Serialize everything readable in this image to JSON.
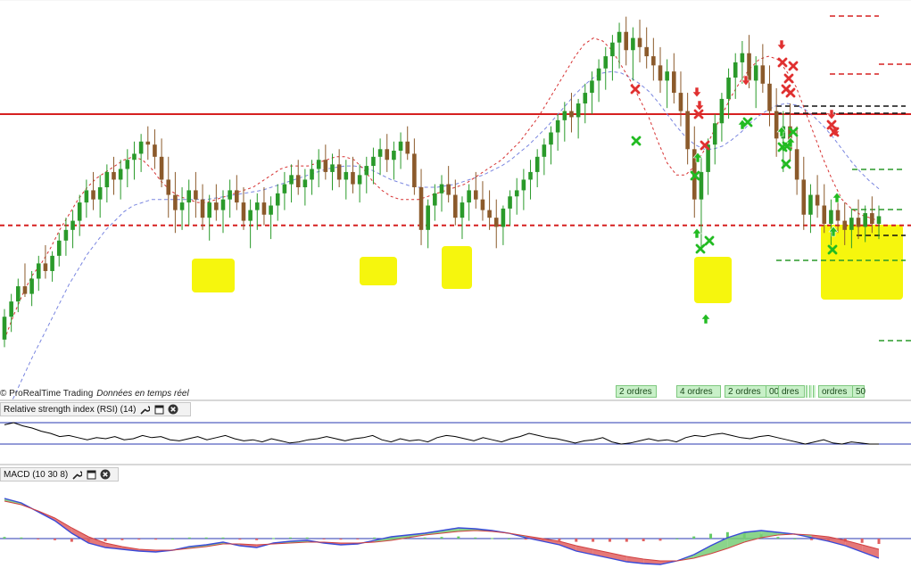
{
  "watermark": {
    "brand": "© ProRealTime Trading",
    "note": "Données en temps réel"
  },
  "order_tags": [
    {
      "label": "2 ordres"
    },
    {
      "label": "4 ordres"
    },
    {
      "label": "2 ordres"
    },
    {
      "label": "00"
    },
    {
      "label": "dres"
    },
    {
      "label": "ordres"
    },
    {
      "label": "50"
    }
  ],
  "rsi_panel": {
    "title": "Relative strength index (RSI) (14)"
  },
  "macd_panel": {
    "title": "MACD (10 30 8)"
  },
  "icons": [
    "wrench-icon",
    "window-icon",
    "close-icon"
  ],
  "colors": {
    "bull": "#2a9a2a",
    "bear": "#8b5a2b",
    "resistance": "#d62020",
    "highlight": "#f5f500",
    "buy_arrow": "#22bb22",
    "sell_arrow": "#e03030",
    "rsi_line": "#000000",
    "macd_line": "#3a4ad8",
    "signal_fill": "#e06060"
  },
  "chart_data": [
    {
      "type": "candlestick",
      "source": "price",
      "candles": [
        [
          300,
          320,
          295,
          315
        ],
        [
          315,
          330,
          305,
          325
        ],
        [
          325,
          340,
          318,
          335
        ],
        [
          335,
          350,
          328,
          330
        ],
        [
          330,
          345,
          322,
          340
        ],
        [
          340,
          355,
          332,
          350
        ],
        [
          350,
          362,
          340,
          345
        ],
        [
          345,
          358,
          338,
          355
        ],
        [
          355,
          370,
          348,
          365
        ],
        [
          365,
          380,
          355,
          372
        ],
        [
          372,
          385,
          360,
          378
        ],
        [
          378,
          395,
          368,
          390
        ],
        [
          390,
          405,
          380,
          398
        ],
        [
          398,
          410,
          385,
          392
        ],
        [
          392,
          408,
          380,
          400
        ],
        [
          400,
          415,
          390,
          410
        ],
        [
          410,
          420,
          395,
          405
        ],
        [
          405,
          418,
          392,
          412
        ],
        [
          412,
          425,
          400,
          418
        ],
        [
          418,
          430,
          405,
          422
        ],
        [
          422,
          435,
          410,
          430
        ],
        [
          430,
          440,
          418,
          428
        ],
        [
          428,
          438,
          412,
          420
        ],
        [
          420,
          432,
          400,
          405
        ],
        [
          405,
          420,
          380,
          395
        ],
        [
          395,
          410,
          370,
          385
        ],
        [
          385,
          400,
          372,
          390
        ],
        [
          390,
          405,
          375,
          398
        ],
        [
          398,
          410,
          380,
          392
        ],
        [
          392,
          402,
          372,
          380
        ],
        [
          380,
          395,
          365,
          390
        ],
        [
          390,
          402,
          378,
          385
        ],
        [
          385,
          398,
          370,
          392
        ],
        [
          392,
          405,
          380,
          398
        ],
        [
          398,
          408,
          385,
          390
        ],
        [
          390,
          400,
          372,
          378
        ],
        [
          378,
          392,
          360,
          385
        ],
        [
          385,
          396,
          372,
          390
        ],
        [
          390,
          400,
          375,
          382
        ],
        [
          382,
          394,
          366,
          388
        ],
        [
          388,
          402,
          378,
          396
        ],
        [
          396,
          410,
          385,
          402
        ],
        [
          402,
          415,
          390,
          408
        ],
        [
          408,
          418,
          395,
          400
        ],
        [
          400,
          412,
          388,
          405
        ],
        [
          405,
          418,
          395,
          412
        ],
        [
          412,
          425,
          400,
          418
        ],
        [
          418,
          428,
          405,
          410
        ],
        [
          410,
          422,
          398,
          415
        ],
        [
          415,
          425,
          400,
          405
        ],
        [
          405,
          418,
          392,
          410
        ],
        [
          410,
          420,
          396,
          402
        ],
        [
          402,
          415,
          390,
          408
        ],
        [
          408,
          420,
          396,
          414
        ],
        [
          414,
          426,
          402,
          420
        ],
        [
          420,
          432,
          408,
          425
        ],
        [
          425,
          435,
          410,
          418
        ],
        [
          418,
          430,
          405,
          424
        ],
        [
          424,
          436,
          412,
          430
        ],
        [
          430,
          440,
          418,
          422
        ],
        [
          422,
          432,
          395,
          400
        ],
        [
          400,
          412,
          362,
          372
        ],
        [
          372,
          392,
          360,
          388
        ],
        [
          388,
          402,
          378,
          396
        ],
        [
          396,
          408,
          384,
          402
        ],
        [
          402,
          414,
          390,
          395
        ],
        [
          395,
          405,
          375,
          380
        ],
        [
          380,
          394,
          366,
          390
        ],
        [
          390,
          402,
          378,
          398
        ],
        [
          398,
          410,
          386,
          392
        ],
        [
          392,
          404,
          378,
          385
        ],
        [
          385,
          398,
          372,
          380
        ],
        [
          380,
          392,
          360,
          374
        ],
        [
          374,
          388,
          362,
          386
        ],
        [
          386,
          398,
          375,
          394
        ],
        [
          394,
          406,
          382,
          398
        ],
        [
          398,
          412,
          385,
          405
        ],
        [
          405,
          418,
          392,
          410
        ],
        [
          410,
          425,
          400,
          420
        ],
        [
          420,
          432,
          408,
          428
        ],
        [
          428,
          440,
          415,
          436
        ],
        [
          436,
          448,
          424,
          444
        ],
        [
          444,
          456,
          430,
          450
        ],
        [
          450,
          462,
          436,
          446
        ],
        [
          446,
          458,
          432,
          455
        ],
        [
          455,
          468,
          442,
          462
        ],
        [
          462,
          476,
          448,
          470
        ],
        [
          470,
          484,
          456,
          478
        ],
        [
          478,
          492,
          464,
          486
        ],
        [
          486,
          500,
          470,
          495
        ],
        [
          495,
          508,
          478,
          502
        ],
        [
          502,
          512,
          480,
          490
        ],
        [
          490,
          505,
          470,
          498
        ],
        [
          498,
          510,
          482,
          492
        ],
        [
          492,
          505,
          478,
          486
        ],
        [
          486,
          498,
          470,
          480
        ],
        [
          480,
          492,
          462,
          470
        ],
        [
          470,
          484,
          452,
          476
        ],
        [
          476,
          488,
          455,
          462
        ],
        [
          462,
          476,
          440,
          450
        ],
        [
          450,
          462,
          415,
          425
        ],
        [
          425,
          440,
          380,
          392
        ],
        [
          392,
          420,
          360,
          410
        ],
        [
          410,
          432,
          395,
          428
        ],
        [
          428,
          448,
          415,
          442
        ],
        [
          442,
          462,
          430,
          458
        ],
        [
          458,
          478,
          445,
          472
        ],
        [
          472,
          488,
          458,
          482
        ],
        [
          482,
          496,
          468,
          488
        ],
        [
          488,
          500,
          465,
          470
        ],
        [
          470,
          486,
          452,
          480
        ],
        [
          480,
          494,
          462,
          468
        ],
        [
          468,
          480,
          440,
          450
        ],
        [
          450,
          465,
          420,
          432
        ],
        [
          432,
          450,
          410,
          440
        ],
        [
          440,
          455,
          418,
          425
        ],
        [
          425,
          440,
          395,
          405
        ],
        [
          405,
          420,
          372,
          382
        ],
        [
          382,
          402,
          370,
          395
        ],
        [
          395,
          408,
          380,
          388
        ],
        [
          388,
          402,
          370,
          376
        ],
        [
          376,
          392,
          362,
          385
        ],
        [
          385,
          396,
          370,
          378
        ],
        [
          378,
          390,
          362,
          372
        ],
        [
          372,
          386,
          360,
          380
        ],
        [
          380,
          392,
          366,
          374
        ],
        [
          374,
          388,
          364,
          383
        ],
        [
          383,
          394,
          370,
          376
        ],
        [
          376,
          388,
          366,
          381
        ]
      ],
      "support_level": 375,
      "resistance_level": 448,
      "ma_fast": [
        300,
        316,
        330,
        342,
        350,
        360,
        372,
        382,
        392,
        400,
        406,
        410,
        414,
        418,
        420,
        418,
        412,
        404,
        398,
        394,
        392,
        390,
        390,
        392,
        394,
        396,
        398,
        400,
        404,
        408,
        412,
        414,
        414,
        414,
        416,
        418,
        420,
        420,
        418,
        412,
        404,
        398,
        394,
        392,
        392,
        392,
        394,
        396,
        398,
        400,
        402,
        406,
        410,
        414,
        418,
        424,
        430,
        438,
        446,
        456,
        466,
        476,
        486,
        494,
        498,
        496,
        490,
        480,
        470,
        458,
        446,
        430,
        416,
        408,
        408,
        414,
        424,
        436,
        448,
        460,
        470,
        478,
        484,
        486,
        484,
        476,
        466,
        450,
        434,
        418,
        404,
        392,
        386,
        382,
        380,
        378
      ],
      "ma_slow": [
        250,
        262,
        275,
        288,
        300,
        312,
        324,
        336,
        346,
        356,
        364,
        372,
        378,
        384,
        388,
        390,
        392,
        392,
        392,
        392,
        392,
        392,
        392,
        393,
        394,
        395,
        396,
        397,
        398,
        400,
        402,
        404,
        406,
        408,
        410,
        412,
        413,
        414,
        414,
        413,
        411,
        408,
        405,
        403,
        401,
        400,
        400,
        400,
        401,
        402,
        404,
        406,
        408,
        411,
        414,
        418,
        423,
        428,
        434,
        440,
        447,
        454,
        461,
        467,
        472,
        475,
        476,
        475,
        472,
        468,
        463,
        456,
        448,
        440,
        433,
        428,
        425,
        425,
        427,
        431,
        436,
        442,
        447,
        451,
        454,
        455,
        454,
        451,
        446,
        440,
        433,
        425,
        417,
        410,
        404,
        399
      ],
      "annotations": []
    },
    {
      "type": "line",
      "source": "RSI (14)",
      "values": [
        58,
        60,
        57,
        55,
        52,
        50,
        47,
        48,
        46,
        44,
        46,
        45,
        47,
        44,
        45,
        48,
        46,
        47,
        44,
        43,
        45,
        47,
        44,
        46,
        48,
        45,
        43,
        44,
        42,
        45,
        43,
        41,
        42,
        44,
        45,
        47,
        45,
        43,
        45,
        46,
        48,
        44,
        42,
        45,
        43,
        44,
        42,
        46,
        48,
        47,
        45,
        43,
        46,
        44,
        42,
        45,
        47,
        50,
        48,
        46,
        45,
        43,
        41,
        43,
        44,
        46,
        42,
        40,
        41,
        43,
        45,
        43,
        44,
        42,
        46,
        48,
        47,
        49,
        50,
        48,
        46,
        45,
        47,
        48,
        46,
        44,
        42,
        40,
        42,
        44,
        41,
        40,
        42,
        41,
        40,
        40
      ]
    },
    {
      "type": "line",
      "source": "MACD (10 30 8)",
      "macd": [
        4.5,
        4.0,
        3.0,
        2.0,
        0.6,
        -0.5,
        -1.0,
        -1.2,
        -1.4,
        -1.5,
        -1.3,
        -0.9,
        -0.7,
        -0.4,
        -0.8,
        -1.0,
        -0.5,
        -0.3,
        -0.2,
        -0.5,
        -0.7,
        -0.6,
        -0.2,
        0.2,
        0.4,
        0.6,
        0.9,
        1.2,
        1.1,
        0.9,
        0.6,
        0.1,
        -0.3,
        -0.7,
        -1.4,
        -1.8,
        -2.2,
        -2.6,
        -2.8,
        -2.9,
        -2.5,
        -1.8,
        -0.8,
        0.1,
        0.7,
        0.9,
        0.7,
        0.5,
        0.1,
        -0.3,
        -0.8,
        -1.5,
        -2.2
      ],
      "signal": [
        4.2,
        3.8,
        3.1,
        2.3,
        1.2,
        0.2,
        -0.5,
        -0.9,
        -1.2,
        -1.3,
        -1.3,
        -1.1,
        -0.9,
        -0.6,
        -0.6,
        -0.7,
        -0.6,
        -0.5,
        -0.4,
        -0.4,
        -0.5,
        -0.5,
        -0.4,
        -0.2,
        0.1,
        0.4,
        0.6,
        0.8,
        0.9,
        0.8,
        0.6,
        0.3,
        0.0,
        -0.3,
        -0.8,
        -1.2,
        -1.6,
        -2.0,
        -2.3,
        -2.5,
        -2.5,
        -2.2,
        -1.7,
        -1.1,
        -0.4,
        0.1,
        0.4,
        0.5,
        0.4,
        0.2,
        -0.2,
        -0.7,
        -1.2
      ]
    }
  ]
}
